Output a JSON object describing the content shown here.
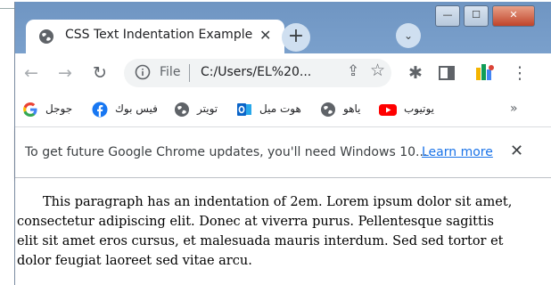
{
  "window": {
    "tab_title": "CSS Text Indentation Example",
    "close_tab_glyph": "✕",
    "new_tab_glyph": "+",
    "tab_search_glyph": "⌄",
    "controls": {
      "minimize": "—",
      "maximize": "☐",
      "close": "✕"
    }
  },
  "toolbar": {
    "back_glyph": "←",
    "forward_glyph": "→",
    "reload_glyph": "↻",
    "address": {
      "file_label": "File",
      "url": "C:/Users/EL%20..."
    },
    "share_glyph": "⇪",
    "star_glyph": "☆",
    "extensions_glyph": "✱",
    "menu_glyph": "⋮"
  },
  "bookmarks": {
    "items": [
      {
        "label": "جوجل",
        "icon": "google-icon"
      },
      {
        "label": "فيس بوك",
        "icon": "facebook-icon"
      },
      {
        "label": "تويتر",
        "icon": "globe-icon"
      },
      {
        "label": "هوت ميل",
        "icon": "outlook-icon"
      },
      {
        "label": "ياهو",
        "icon": "globe-icon"
      },
      {
        "label": "يوتيوب",
        "icon": "youtube-icon"
      }
    ],
    "more_glyph": "»"
  },
  "infobar": {
    "message": "To get future Google Chrome updates, you'll need Windows 10...",
    "link": "Learn more",
    "close_glyph": "✕"
  },
  "page": {
    "paragraph": "This paragraph has an indentation of 2em. Lorem ipsum dolor sit amet, consectetur adipiscing elit. Donec at viverra purus. Pellentesque sagittis elit sit amet eros cursus, et malesuada mauris interdum. Sed sed tortor et dolor feugiat laoreet sed vitae arcu."
  },
  "colors": {
    "titlebar": "#7a9ec9",
    "link": "#1a73e8",
    "youtube": "#ff0000",
    "facebook": "#1877f2",
    "outlook": "#0a64c8"
  }
}
